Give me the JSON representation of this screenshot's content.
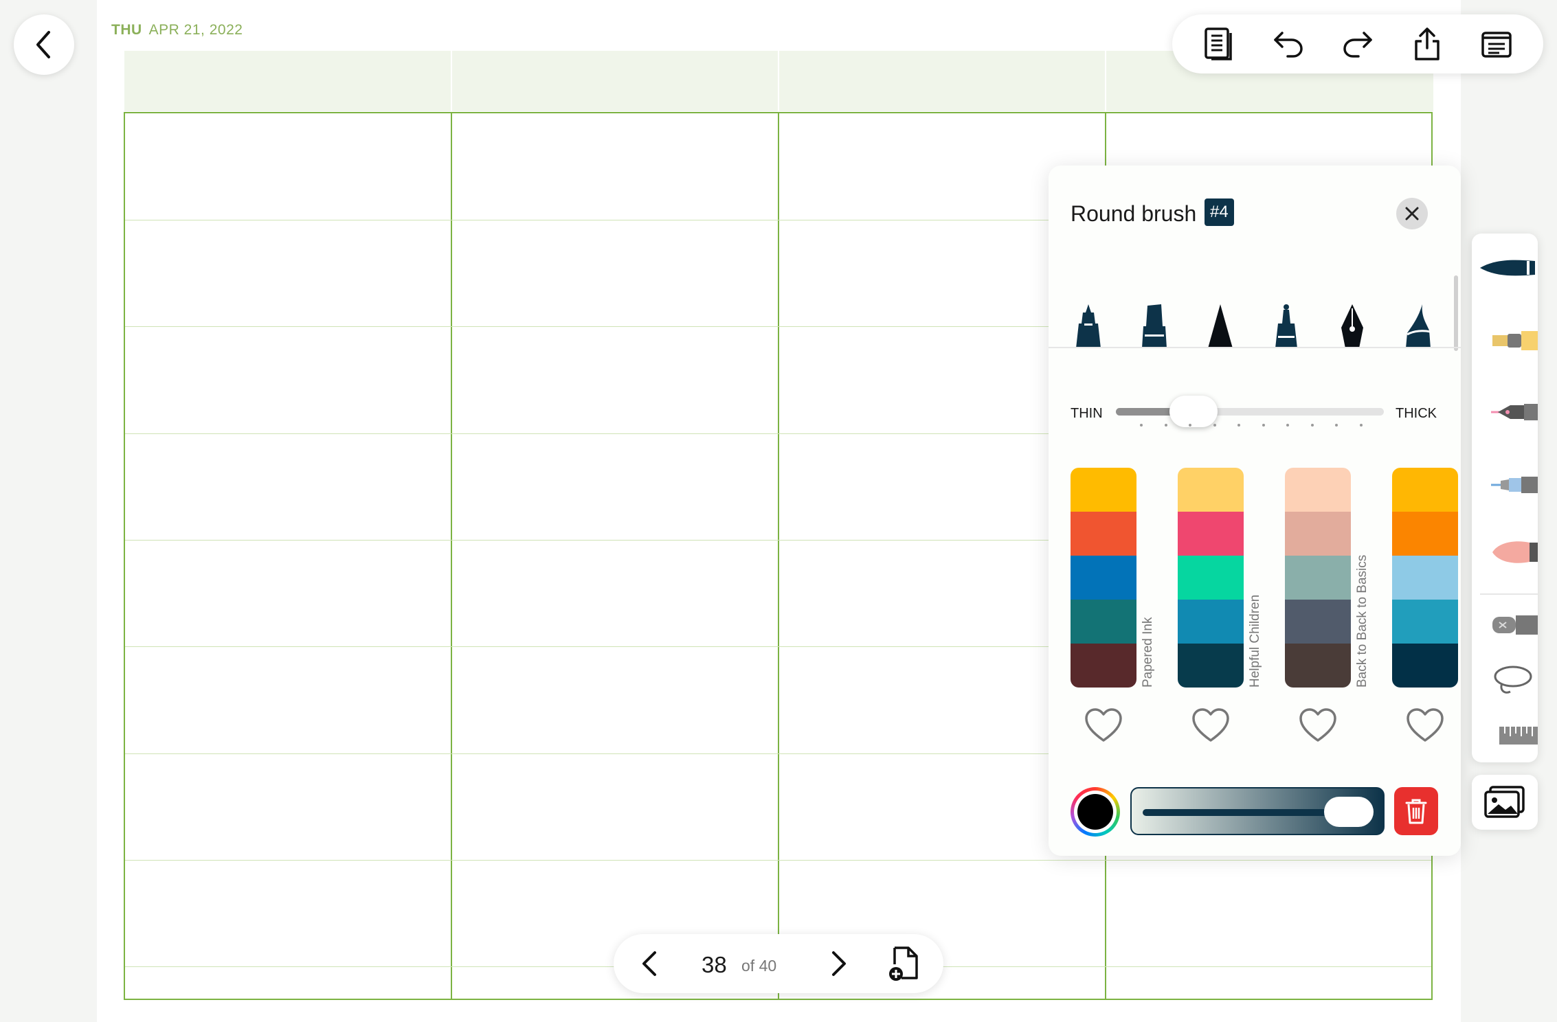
{
  "date": {
    "day": "THU",
    "date": "APR 21, 2022"
  },
  "topbar": {
    "icons": [
      "pages-icon",
      "undo-icon",
      "redo-icon",
      "share-icon",
      "menu-icon"
    ]
  },
  "brush_panel": {
    "title": "Round brush",
    "badge": "#4",
    "tips": [
      "fineliner-tip",
      "marker-tip",
      "pencil-tip",
      "ballpoint-tip",
      "fountain-pen-tip",
      "brush-tip"
    ],
    "size": {
      "thin_label": "THIN",
      "thick_label": "THICK",
      "level_fraction": 0.2
    },
    "palettes": [
      {
        "name": "Papered Ink",
        "colors": [
          "#ffbb00",
          "#f05530",
          "#0273b8",
          "#137375",
          "#58292b"
        ]
      },
      {
        "name": "Helpful Children",
        "colors": [
          "#ffd166",
          "#ef476f",
          "#06d6a0",
          "#118ab2",
          "#073b4c"
        ]
      },
      {
        "name": "Back to Back to Basics",
        "colors": [
          "#fdd1b6",
          "#e2ac9c",
          "#8aafaa",
          "#515b6b",
          "#4a3c38"
        ]
      },
      {
        "name": "",
        "colors": [
          "#ffb703",
          "#fb8500",
          "#8ecae6",
          "#219ebc",
          "#023047"
        ]
      }
    ],
    "current_color": "#000000",
    "opacity_fraction": 1.0,
    "accent": "#0d3349",
    "delete_color": "#e8302e"
  },
  "tools": [
    "round-brush-tool",
    "highlighter-tool",
    "fountain-pen-tool",
    "pen-tool",
    "soft-brush-tool",
    "eraser-tool",
    "lasso-tool",
    "ruler-tool"
  ],
  "pager": {
    "current": "38",
    "total_label": "of 40"
  },
  "colors": {
    "grid_line": "#7cb342",
    "grid_light": "#cfe3b6",
    "date_green": "#8bb05a"
  }
}
